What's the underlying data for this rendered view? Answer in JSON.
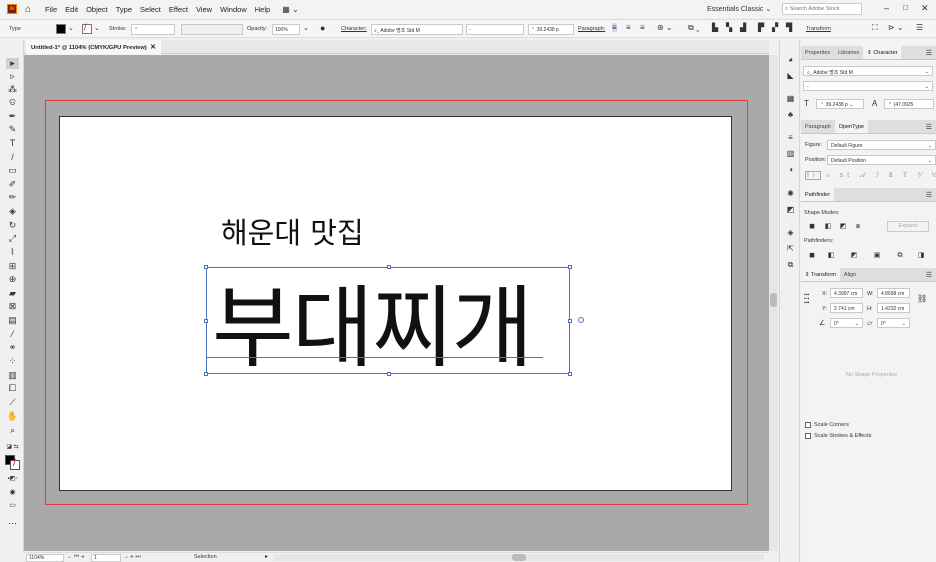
{
  "app": {
    "icon_text": "Ai"
  },
  "menubar": {
    "items": [
      "File",
      "Edit",
      "Object",
      "Type",
      "Select",
      "Effect",
      "View",
      "Window",
      "Help"
    ],
    "workspace": "Essentials Classic",
    "search_placeholder": "Search Adobe Stock"
  },
  "controlbar": {
    "type_label": "Type",
    "stroke_label": "Stroke:",
    "opacity_label": "Opacity:",
    "opacity_value": "100%",
    "character_label": "Character:",
    "font_family": "Adobe 명조 Std M",
    "font_style": "-",
    "font_size": "39.2438 p",
    "paragraph_label": "Paragraph:",
    "transform_label": "Transform"
  },
  "document": {
    "tab_title": "Untitled-1* @ 1104% (CMYK/GPU Preview)",
    "subtitle_text": "해운대 맛집",
    "headline_text": "부대찌개"
  },
  "statusbar": {
    "zoom": "1104%",
    "artboard_number": "1",
    "tool_name": "Selection"
  },
  "panels": {
    "top_tabs": [
      "Properties",
      "Libraries",
      "Character"
    ],
    "character": {
      "font_family": "Adobe 명조 Std M",
      "font_style": "-",
      "font_size": "39.2438 p",
      "leading": "(47.0925"
    },
    "para_tabs": [
      "Paragraph",
      "OpenType"
    ],
    "opentype": {
      "figure_label": "Figure:",
      "figure_value": "Default Figure",
      "position_label": "Position:",
      "position_value": "Default Position"
    },
    "pathfinder": {
      "title": "Pathfinder",
      "shape_modes_label": "Shape Modes:",
      "expand_label": "Expand",
      "pathfinders_label": "Pathfinders:"
    },
    "transform_tabs": [
      "Transform",
      "Align"
    ],
    "transform": {
      "x_label": "X:",
      "x_value": "4.3997 cm",
      "w_label": "W:",
      "w_value": "4.8698 cm",
      "y_label": "Y:",
      "y_value": "2.741 cm",
      "h_label": "H:",
      "h_value": "1.4232 cm",
      "rotate_value": "0°",
      "shear_value": "0°",
      "no_shape_text": "No Shape Properties",
      "scale_corners_label": "Scale Corners",
      "scale_strokes_label": "Scale Strokes & Effects"
    }
  },
  "colors": {
    "accent_selection": "#4b72c7",
    "bleed_line": "#e83a3a",
    "canvas_gray": "#a9a9a9"
  }
}
